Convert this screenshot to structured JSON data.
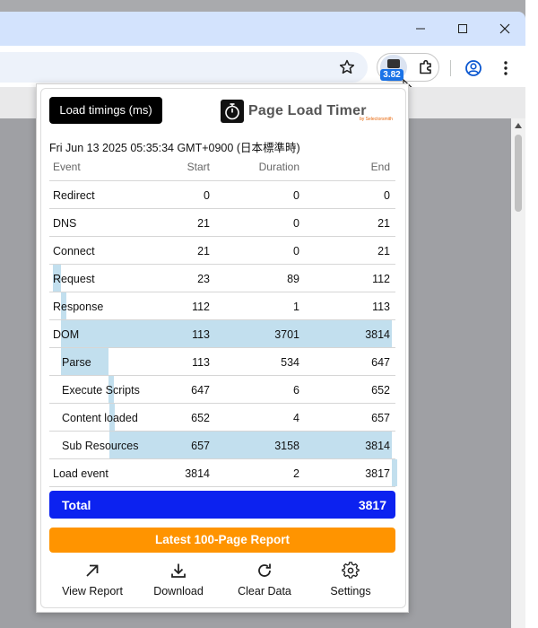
{
  "browser": {
    "extension_badge": "3.82"
  },
  "popup": {
    "load_timings_label": "Load timings (ms)",
    "logo_title": "Page Load Timer",
    "logo_sub": "by Selectorsmith",
    "timestamp": "Fri Jun 13 2025 05:35:34 GMT+0900 (日本標準時)",
    "columns": [
      "Event",
      "Start",
      "Duration",
      "End"
    ],
    "rows": [
      {
        "event": "Redirect",
        "start": "0",
        "duration": "0",
        "end": "0",
        "indent": false
      },
      {
        "event": "DNS",
        "start": "21",
        "duration": "0",
        "end": "21",
        "indent": false
      },
      {
        "event": "Connect",
        "start": "21",
        "duration": "0",
        "end": "21",
        "indent": false
      },
      {
        "event": "Request",
        "start": "23",
        "duration": "89",
        "end": "112",
        "indent": false
      },
      {
        "event": "Response",
        "start": "112",
        "duration": "1",
        "end": "113",
        "indent": false
      },
      {
        "event": "DOM",
        "start": "113",
        "duration": "3701",
        "end": "3814",
        "indent": false
      },
      {
        "event": "Parse",
        "start": "113",
        "duration": "534",
        "end": "647",
        "indent": true
      },
      {
        "event": "Execute Scripts",
        "start": "647",
        "duration": "6",
        "end": "652",
        "indent": true
      },
      {
        "event": "Content loaded",
        "start": "652",
        "duration": "4",
        "end": "657",
        "indent": true
      },
      {
        "event": "Sub Resources",
        "start": "657",
        "duration": "3158",
        "end": "3814",
        "indent": true
      },
      {
        "event": "Load event",
        "start": "3814",
        "duration": "2",
        "end": "3817",
        "indent": false
      }
    ],
    "total_label": "Total",
    "total_value": "3817",
    "report_button": "Latest 100-Page Report",
    "actions": {
      "view_report": "View Report",
      "download": "Download",
      "clear_data": "Clear Data",
      "settings": "Settings"
    },
    "colors": {
      "timeline_bar": "#c2dfee",
      "total_bg": "#0c22f0",
      "report_bg": "#ff9400"
    }
  }
}
